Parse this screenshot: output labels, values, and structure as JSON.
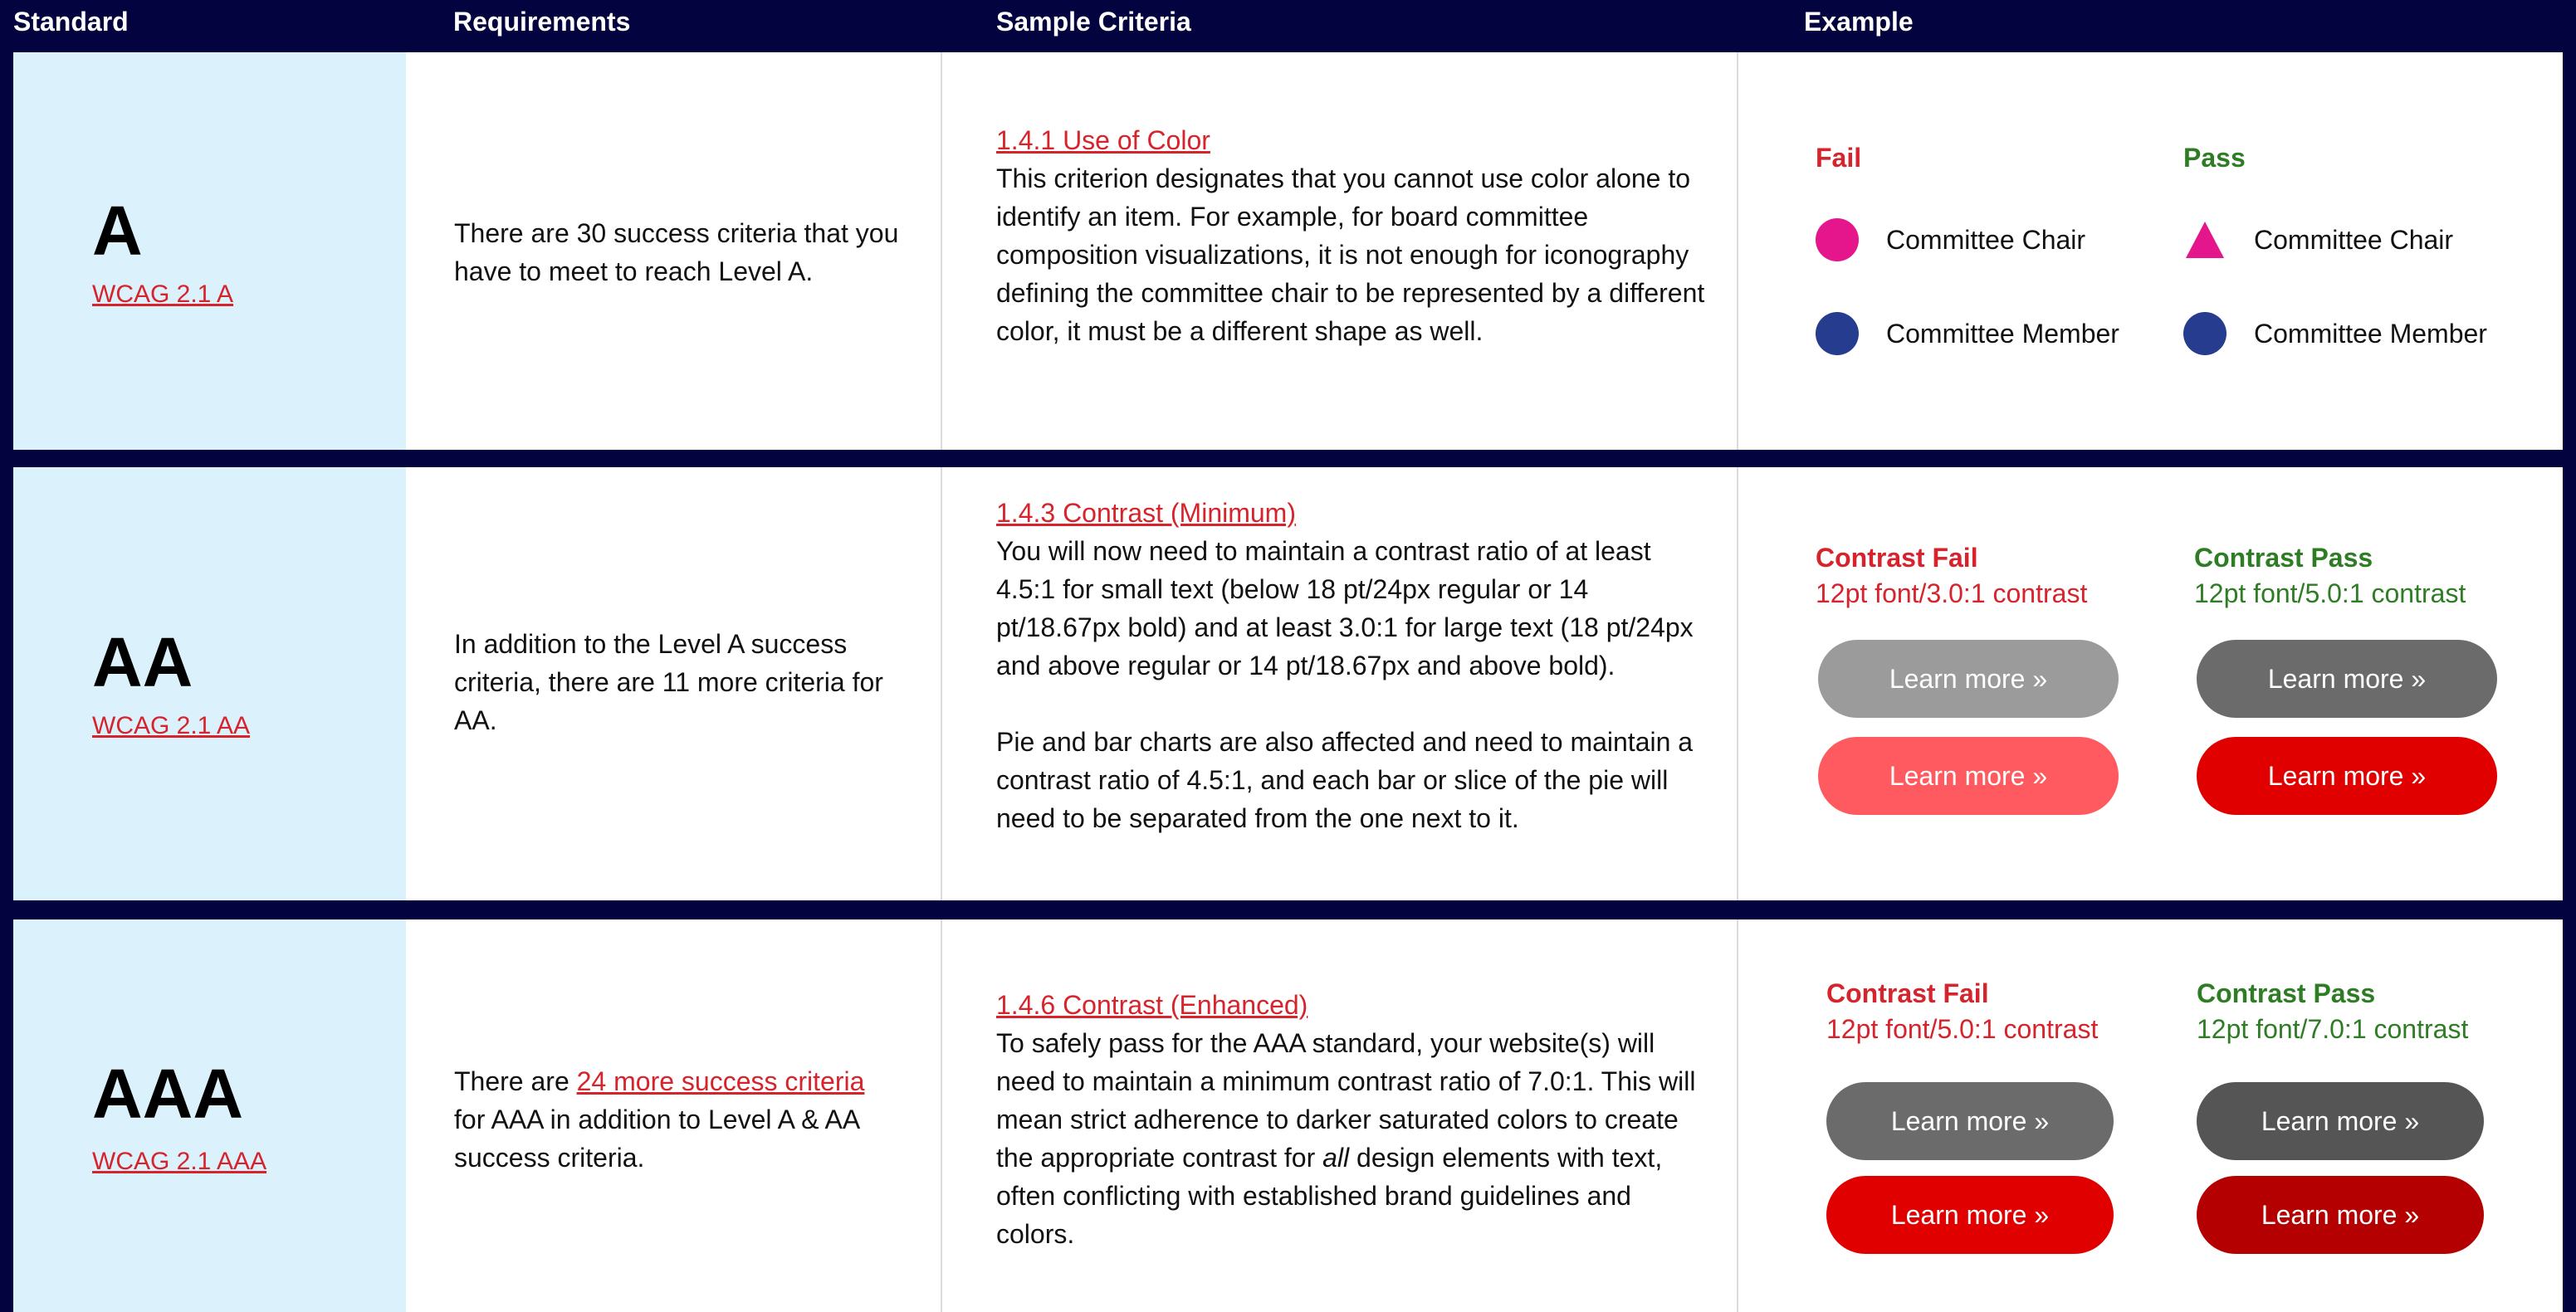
{
  "header": {
    "standard": "Standard",
    "requirements": "Requirements",
    "sample_criteria": "Sample Criteria",
    "example": "Example"
  },
  "rows": [
    {
      "level": "A",
      "link": "WCAG 2.1 A",
      "requirement": "There are 30 success criteria that you have to meet to reach Level A.",
      "criterion_link": "1.4.1 Use of Color",
      "criterion_text": "This criterion designates that you cannot use color alone to identify an item. For example, for board committee composition visualizations, it is not enough for iconography defining the committee chair to be represented by a different color, it must be a different shape as well.",
      "example": {
        "fail_label": "Fail",
        "pass_label": "Pass",
        "fail_items": [
          {
            "label": "Committee Chair",
            "icon": "pink-circle-icon",
            "color": "#e5168b"
          },
          {
            "label": "Committee Member",
            "icon": "navy-circle-icon",
            "color": "#263c8e"
          }
        ],
        "pass_items": [
          {
            "label": "Committee Chair",
            "icon": "pink-triangle-icon",
            "color": "#e5168b"
          },
          {
            "label": "Committee Member",
            "icon": "navy-circle-icon",
            "color": "#263c8e"
          }
        ]
      }
    },
    {
      "level": "AA",
      "link": "WCAG 2.1 AA",
      "requirement": "In addition to the Level A success criteria, there are 11 more criteria for AA.",
      "criterion_link": "1.4.3 Contrast (Minimum)",
      "criterion_paragraphs": [
        "You will now need to maintain a contrast ratio of  at least 4.5:1 for small text (below 18 pt/24px regular or 14 pt/18.67px bold) and at least 3.0:1 for large text (18 pt/24px and above regular or 14 pt/18.67px and above bold).",
        "Pie and bar charts are also affected and need to maintain a contrast ratio of 4.5:1, and each bar or slice of the pie will need to be separated from the one next to it."
      ],
      "example": {
        "fail_label": "Contrast Fail",
        "fail_sub": "12pt font/3.0:1 contrast",
        "pass_label": "Contrast Pass",
        "pass_sub": "12pt font/5.0:1 contrast",
        "button_label": "Learn more »",
        "fail_buttons": [
          "#9b9b9b",
          "#ff5a5f"
        ],
        "pass_buttons": [
          "#6b6b6b",
          "#e00000"
        ]
      }
    },
    {
      "level": "AAA",
      "link": "WCAG 2.1 AAA",
      "requirement_before": "There are ",
      "requirement_link": "24 more success criteria",
      "requirement_after": " for AAA in addition to Level A & AA success criteria.",
      "criterion_link": "1.4.6 Contrast (Enhanced)",
      "criterion_before": "To safely pass for the AAA standard, your website(s) will need to maintain a minimum contrast ratio of 7.0:1. This will mean strict adherence to darker saturated colors to create the appropriate contrast for ",
      "criterion_em": "all",
      "criterion_after": " design elements with text, often conflicting with established brand guidelines and colors.",
      "example": {
        "fail_label": "Contrast Fail",
        "fail_sub": "12pt font/5.0:1 contrast",
        "pass_label": "Contrast Pass",
        "pass_sub": "12pt font/7.0:1 contrast",
        "button_label": "Learn more »",
        "fail_buttons": [
          "#6b6b6b",
          "#e00000"
        ],
        "pass_buttons": [
          "#555555",
          "#b40000"
        ]
      }
    }
  ],
  "colors": {
    "background": "#02033f",
    "standard_column": "#dbf1fc",
    "link": "#d6232c",
    "fail": "#d6232c",
    "pass": "#2e7d24"
  }
}
